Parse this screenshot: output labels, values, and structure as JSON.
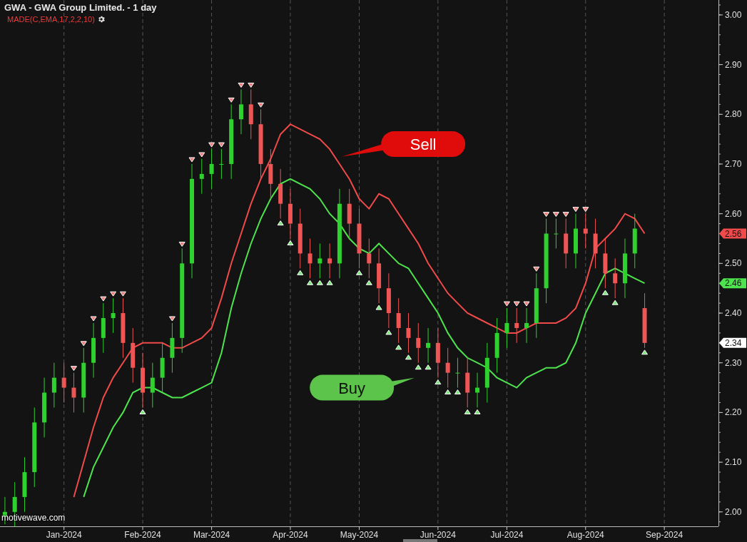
{
  "header": {
    "title": "GWA - GWA Group Limited. - 1 day",
    "indicator": "MADE(C,EMA,17,2,2,10)"
  },
  "chart_data": {
    "type": "candlestick",
    "categories": [
      null,
      null,
      null,
      null,
      null,
      null,
      "Jan-2024",
      null,
      null,
      null,
      null,
      null,
      null,
      null,
      "Feb-2024",
      null,
      null,
      null,
      null,
      null,
      null,
      "Mar-2024",
      null,
      null,
      null,
      null,
      null,
      null,
      null,
      "Apr-2024",
      null,
      null,
      null,
      null,
      null,
      null,
      "May-2024",
      null,
      null,
      null,
      null,
      null,
      null,
      null,
      "Jun-2024",
      null,
      null,
      null,
      null,
      null,
      null,
      "Jul-2024",
      null,
      null,
      null,
      null,
      null,
      null,
      null,
      "Aug-2024",
      null,
      null,
      null,
      null,
      null,
      null,
      null,
      "Sep-2024"
    ],
    "grid": true,
    "ylim": [
      1.971,
      3.03
    ],
    "yticks": [
      {
        "value": 2.0,
        "label": "2.00"
      },
      {
        "value": 2.1,
        "label": "2.10"
      },
      {
        "value": 2.2,
        "label": "2.20"
      },
      {
        "value": 2.3,
        "label": "2.30"
      },
      {
        "value": 2.4,
        "label": "2.40"
      },
      {
        "value": 2.5,
        "label": "2.50"
      },
      {
        "value": 2.6,
        "label": "2.60"
      },
      {
        "value": 2.7,
        "label": "2.70"
      },
      {
        "value": 2.8,
        "label": "2.80"
      },
      {
        "value": 2.9,
        "label": "2.90"
      },
      {
        "value": 3.0,
        "label": "3.00"
      }
    ],
    "ohlc": [
      [
        1.99,
        2.03,
        1.975,
        2.0
      ],
      [
        2.0,
        2.06,
        1.97,
        2.03
      ],
      [
        2.03,
        2.11,
        2.0,
        2.08
      ],
      [
        2.08,
        2.21,
        2.05,
        2.18
      ],
      [
        2.18,
        2.27,
        2.15,
        2.24
      ],
      [
        2.24,
        2.3,
        2.21,
        2.27
      ],
      [
        2.27,
        2.3,
        2.22,
        2.25
      ],
      [
        2.25,
        2.28,
        2.2,
        2.23
      ],
      [
        2.23,
        2.33,
        2.2,
        2.3
      ],
      [
        2.3,
        2.38,
        2.27,
        2.35
      ],
      [
        2.35,
        2.42,
        2.32,
        2.39
      ],
      [
        2.39,
        2.43,
        2.36,
        2.4
      ],
      [
        2.4,
        2.43,
        2.31,
        2.34
      ],
      [
        2.34,
        2.37,
        2.26,
        2.29
      ],
      [
        2.29,
        2.32,
        2.21,
        2.24
      ],
      [
        2.24,
        2.3,
        2.21,
        2.27
      ],
      [
        2.27,
        2.34,
        2.24,
        2.31
      ],
      [
        2.31,
        2.38,
        2.28,
        2.35
      ],
      [
        2.35,
        2.53,
        2.32,
        2.5
      ],
      [
        2.5,
        2.7,
        2.47,
        2.67
      ],
      [
        2.67,
        2.71,
        2.64,
        2.68
      ],
      [
        2.68,
        2.73,
        2.65,
        2.7
      ],
      [
        2.7,
        2.73,
        2.67,
        2.7
      ],
      [
        2.7,
        2.82,
        2.67,
        2.79
      ],
      [
        2.79,
        2.85,
        2.76,
        2.82
      ],
      [
        2.82,
        2.85,
        2.75,
        2.78
      ],
      [
        2.78,
        2.81,
        2.67,
        2.7
      ],
      [
        2.7,
        2.73,
        2.63,
        2.66
      ],
      [
        2.66,
        2.69,
        2.59,
        2.62
      ],
      [
        2.62,
        2.65,
        2.55,
        2.58
      ],
      [
        2.58,
        2.61,
        2.49,
        2.52
      ],
      [
        2.52,
        2.55,
        2.47,
        2.5
      ],
      [
        2.5,
        2.54,
        2.47,
        2.51
      ],
      [
        2.51,
        2.54,
        2.47,
        2.5
      ],
      [
        2.5,
        2.65,
        2.47,
        2.62
      ],
      [
        2.62,
        2.65,
        2.55,
        2.58
      ],
      [
        2.58,
        2.61,
        2.49,
        2.52
      ],
      [
        2.52,
        2.55,
        2.47,
        2.5
      ],
      [
        2.5,
        2.53,
        2.42,
        2.45
      ],
      [
        2.45,
        2.48,
        2.37,
        2.4
      ],
      [
        2.4,
        2.43,
        2.34,
        2.37
      ],
      [
        2.37,
        2.4,
        2.32,
        2.35
      ],
      [
        2.35,
        2.38,
        2.3,
        2.33
      ],
      [
        2.33,
        2.37,
        2.3,
        2.34
      ],
      [
        2.34,
        2.37,
        2.27,
        2.3
      ],
      [
        2.3,
        2.33,
        2.25,
        2.28
      ],
      [
        2.28,
        2.31,
        2.25,
        2.28
      ],
      [
        2.28,
        2.31,
        2.21,
        2.24
      ],
      [
        2.24,
        2.28,
        2.21,
        2.25
      ],
      [
        2.25,
        2.34,
        2.22,
        2.31
      ],
      [
        2.31,
        2.39,
        2.28,
        2.36
      ],
      [
        2.36,
        2.41,
        2.33,
        2.38
      ],
      [
        2.38,
        2.41,
        2.34,
        2.37
      ],
      [
        2.37,
        2.41,
        2.34,
        2.38
      ],
      [
        2.38,
        2.48,
        2.35,
        2.45
      ],
      [
        2.45,
        2.59,
        2.42,
        2.56
      ],
      [
        2.56,
        2.59,
        2.53,
        2.56
      ],
      [
        2.56,
        2.59,
        2.49,
        2.52
      ],
      [
        2.52,
        2.6,
        2.49,
        2.57
      ],
      [
        2.57,
        2.6,
        2.53,
        2.56
      ],
      [
        2.56,
        2.59,
        2.49,
        2.52
      ],
      [
        2.52,
        2.55,
        2.45,
        2.48
      ],
      [
        2.48,
        2.51,
        2.43,
        2.46
      ],
      [
        2.46,
        2.55,
        2.43,
        2.52
      ],
      [
        2.52,
        2.6,
        2.49,
        2.57
      ],
      [
        2.41,
        2.44,
        2.33,
        2.34
      ],
      null,
      null
    ],
    "series": [
      {
        "type": "line",
        "color": "#f04a4a",
        "values": [
          null,
          null,
          null,
          null,
          null,
          null,
          null,
          2.03,
          2.1,
          2.17,
          2.23,
          2.27,
          2.3,
          2.33,
          2.34,
          2.34,
          2.34,
          2.33,
          2.33,
          2.34,
          2.35,
          2.37,
          2.43,
          2.5,
          2.56,
          2.62,
          2.67,
          2.71,
          2.76,
          2.78,
          2.77,
          2.76,
          2.75,
          2.73,
          2.7,
          2.67,
          2.63,
          2.61,
          2.64,
          2.63,
          2.6,
          2.57,
          2.54,
          2.5,
          2.47,
          2.44,
          2.42,
          2.4,
          2.39,
          2.38,
          2.37,
          2.36,
          2.36,
          2.37,
          2.38,
          2.38,
          2.38,
          2.39,
          2.41,
          2.46,
          2.53,
          2.55,
          2.57,
          2.6,
          2.59,
          2.56,
          null,
          null
        ]
      },
      {
        "type": "line",
        "color": "#4ee44e",
        "values": [
          null,
          null,
          null,
          null,
          null,
          null,
          null,
          null,
          2.03,
          2.09,
          2.13,
          2.17,
          2.2,
          2.24,
          2.25,
          2.25,
          2.24,
          2.23,
          2.23,
          2.24,
          2.25,
          2.26,
          2.32,
          2.41,
          2.48,
          2.54,
          2.59,
          2.63,
          2.66,
          2.67,
          2.66,
          2.65,
          2.63,
          2.6,
          2.58,
          2.55,
          2.53,
          2.52,
          2.54,
          2.52,
          2.5,
          2.49,
          2.46,
          2.43,
          2.4,
          2.36,
          2.33,
          2.31,
          2.3,
          2.29,
          2.27,
          2.26,
          2.25,
          2.27,
          2.28,
          2.29,
          2.29,
          2.3,
          2.34,
          2.4,
          2.44,
          2.48,
          2.49,
          2.48,
          2.47,
          2.46,
          null,
          null
        ]
      }
    ],
    "annotations": [
      "Sell",
      "Buy"
    ]
  },
  "price_tags": [
    {
      "text": "2.56",
      "color": "#f04a4a"
    },
    {
      "text": "2.46",
      "color": "#4ee44e"
    },
    {
      "text": "2.34",
      "color": "#ffffff"
    }
  ],
  "branding": "motivewave.com"
}
